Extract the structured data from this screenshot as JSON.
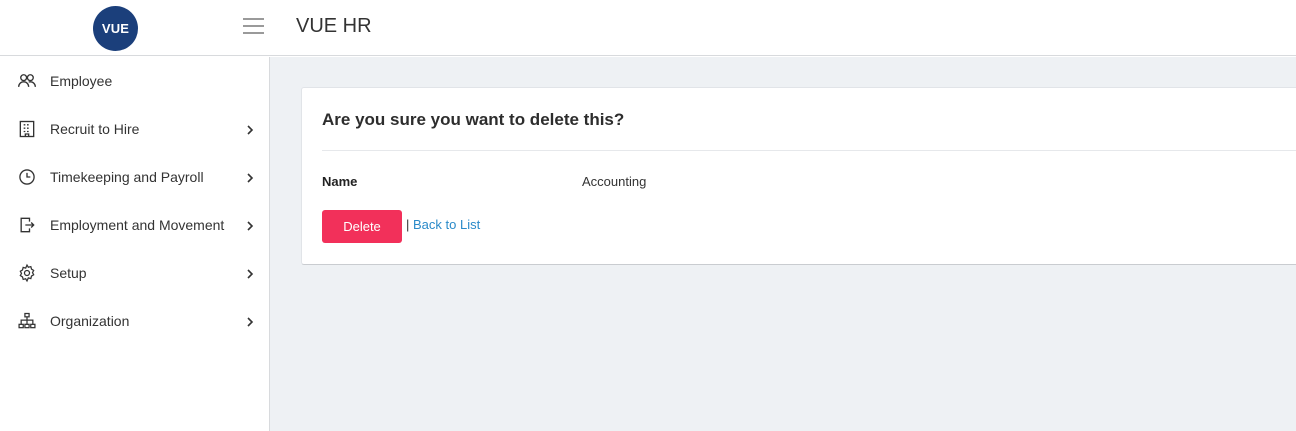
{
  "header": {
    "logo_text": "VUE",
    "logo_color": "#1b3f7b",
    "menu_icon": "hamburger-icon",
    "app_title": "VUE HR"
  },
  "sidebar": {
    "items": [
      {
        "label": "Employee",
        "icon": "users-icon",
        "has_submenu": false
      },
      {
        "label": "Recruit to Hire",
        "icon": "building-icon",
        "has_submenu": true
      },
      {
        "label": "Timekeeping and Payroll",
        "icon": "clock-icon",
        "has_submenu": true
      },
      {
        "label": "Employment and Movement",
        "icon": "exit-icon",
        "has_submenu": true
      },
      {
        "label": "Setup",
        "icon": "gear-icon",
        "has_submenu": true
      },
      {
        "label": "Organization",
        "icon": "org-chart-icon",
        "has_submenu": true
      }
    ]
  },
  "confirm": {
    "title": "Are you sure you want to delete this?",
    "field_label": "Name",
    "field_value": "Accounting",
    "delete_label": "Delete",
    "separator": "|",
    "back_label": "Back to List",
    "delete_color": "#f2305a",
    "link_color": "#2a8ac9"
  }
}
